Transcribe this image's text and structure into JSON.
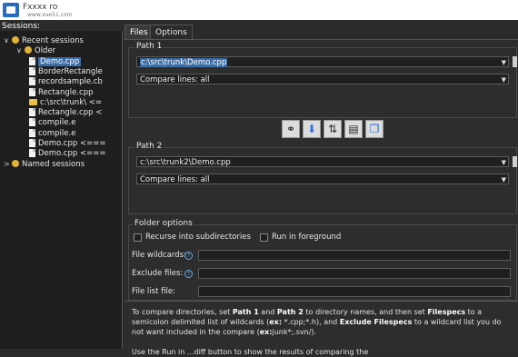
{
  "window": {
    "title": "Fxxxx ro",
    "subtitle": "www.xue51.com"
  },
  "sessions_label": "Sessions:",
  "tree": [
    {
      "label": "Recent sessions",
      "icon": "session-icon",
      "indent": 0,
      "chevron": "∨"
    },
    {
      "label": "Older",
      "icon": "session-icon",
      "indent": 1,
      "chevron": "∨"
    },
    {
      "label": "Demo.cpp",
      "icon": "document-icon",
      "indent": 2,
      "selected": true
    },
    {
      "label": "BorderRectangle",
      "icon": "document-icon",
      "indent": 2
    },
    {
      "label": "recordsample.cb",
      "icon": "document-icon",
      "indent": 2
    },
    {
      "label": "Rectangle.cpp",
      "icon": "document-icon",
      "indent": 2
    },
    {
      "label": "c:\\src\\trunk\\ <=",
      "icon": "folder-icon",
      "indent": 2
    },
    {
      "label": "Rectangle.cpp <",
      "icon": "document-icon",
      "indent": 2
    },
    {
      "label": "compile.e",
      "icon": "document-icon",
      "indent": 2
    },
    {
      "label": "compile.e",
      "icon": "document-icon",
      "indent": 2
    },
    {
      "label": "Demo.cpp <===",
      "icon": "document-icon",
      "indent": 2
    },
    {
      "label": "Demo.cpp <===",
      "icon": "document-icon",
      "indent": 2
    },
    {
      "label": "Named sessions",
      "icon": "session-icon",
      "indent": 0,
      "chevron": ">"
    }
  ],
  "tabs": [
    "Files",
    "Options"
  ],
  "path1": {
    "label": "Path 1",
    "value": "c:\\src\\trunk\\Demo.cpp",
    "compare": "Compare lines: all"
  },
  "path2": {
    "label": "Path 2",
    "value": "c:\\src\\trunk2\\Demo.cpp",
    "compare": "Compare lines: all"
  },
  "toolbar": [
    {
      "name": "link-icon",
      "glyph": "🔗"
    },
    {
      "name": "arrow-down-icon",
      "glyph": "⬇"
    },
    {
      "name": "swap-icon",
      "glyph": "⇅"
    },
    {
      "name": "report-icon",
      "glyph": "▤"
    },
    {
      "name": "copy-icon",
      "glyph": "❐"
    }
  ],
  "folder_options": {
    "label": "Folder options",
    "recurse": "Recurse into subdirectories",
    "foreground": "Run in foreground",
    "wildcards_label": "File wildcards:",
    "exclude_label": "Exclude files:",
    "list_label": "File list file:"
  },
  "help": {
    "p1_a": "To compare directories, set ",
    "p1_b": "Path 1",
    "p1_c": " and ",
    "p1_d": "Path 2",
    "p1_e": " to directory names, and then set ",
    "p1_f": "Filespecs",
    "p1_g": " to a semicolon delimited list of wildcards (",
    "p1_h": "ex:",
    "p1_i": " *.cpp;*.h), and ",
    "p1_j": "Exclude Filespecs",
    "p1_k": " to a wildcard list you do not want included in the compare (",
    "p1_l": "ex:",
    "p1_m": "junk*;.svn/).",
    "p2": "Use the Run in ...diff button to show the results of comparing the"
  }
}
